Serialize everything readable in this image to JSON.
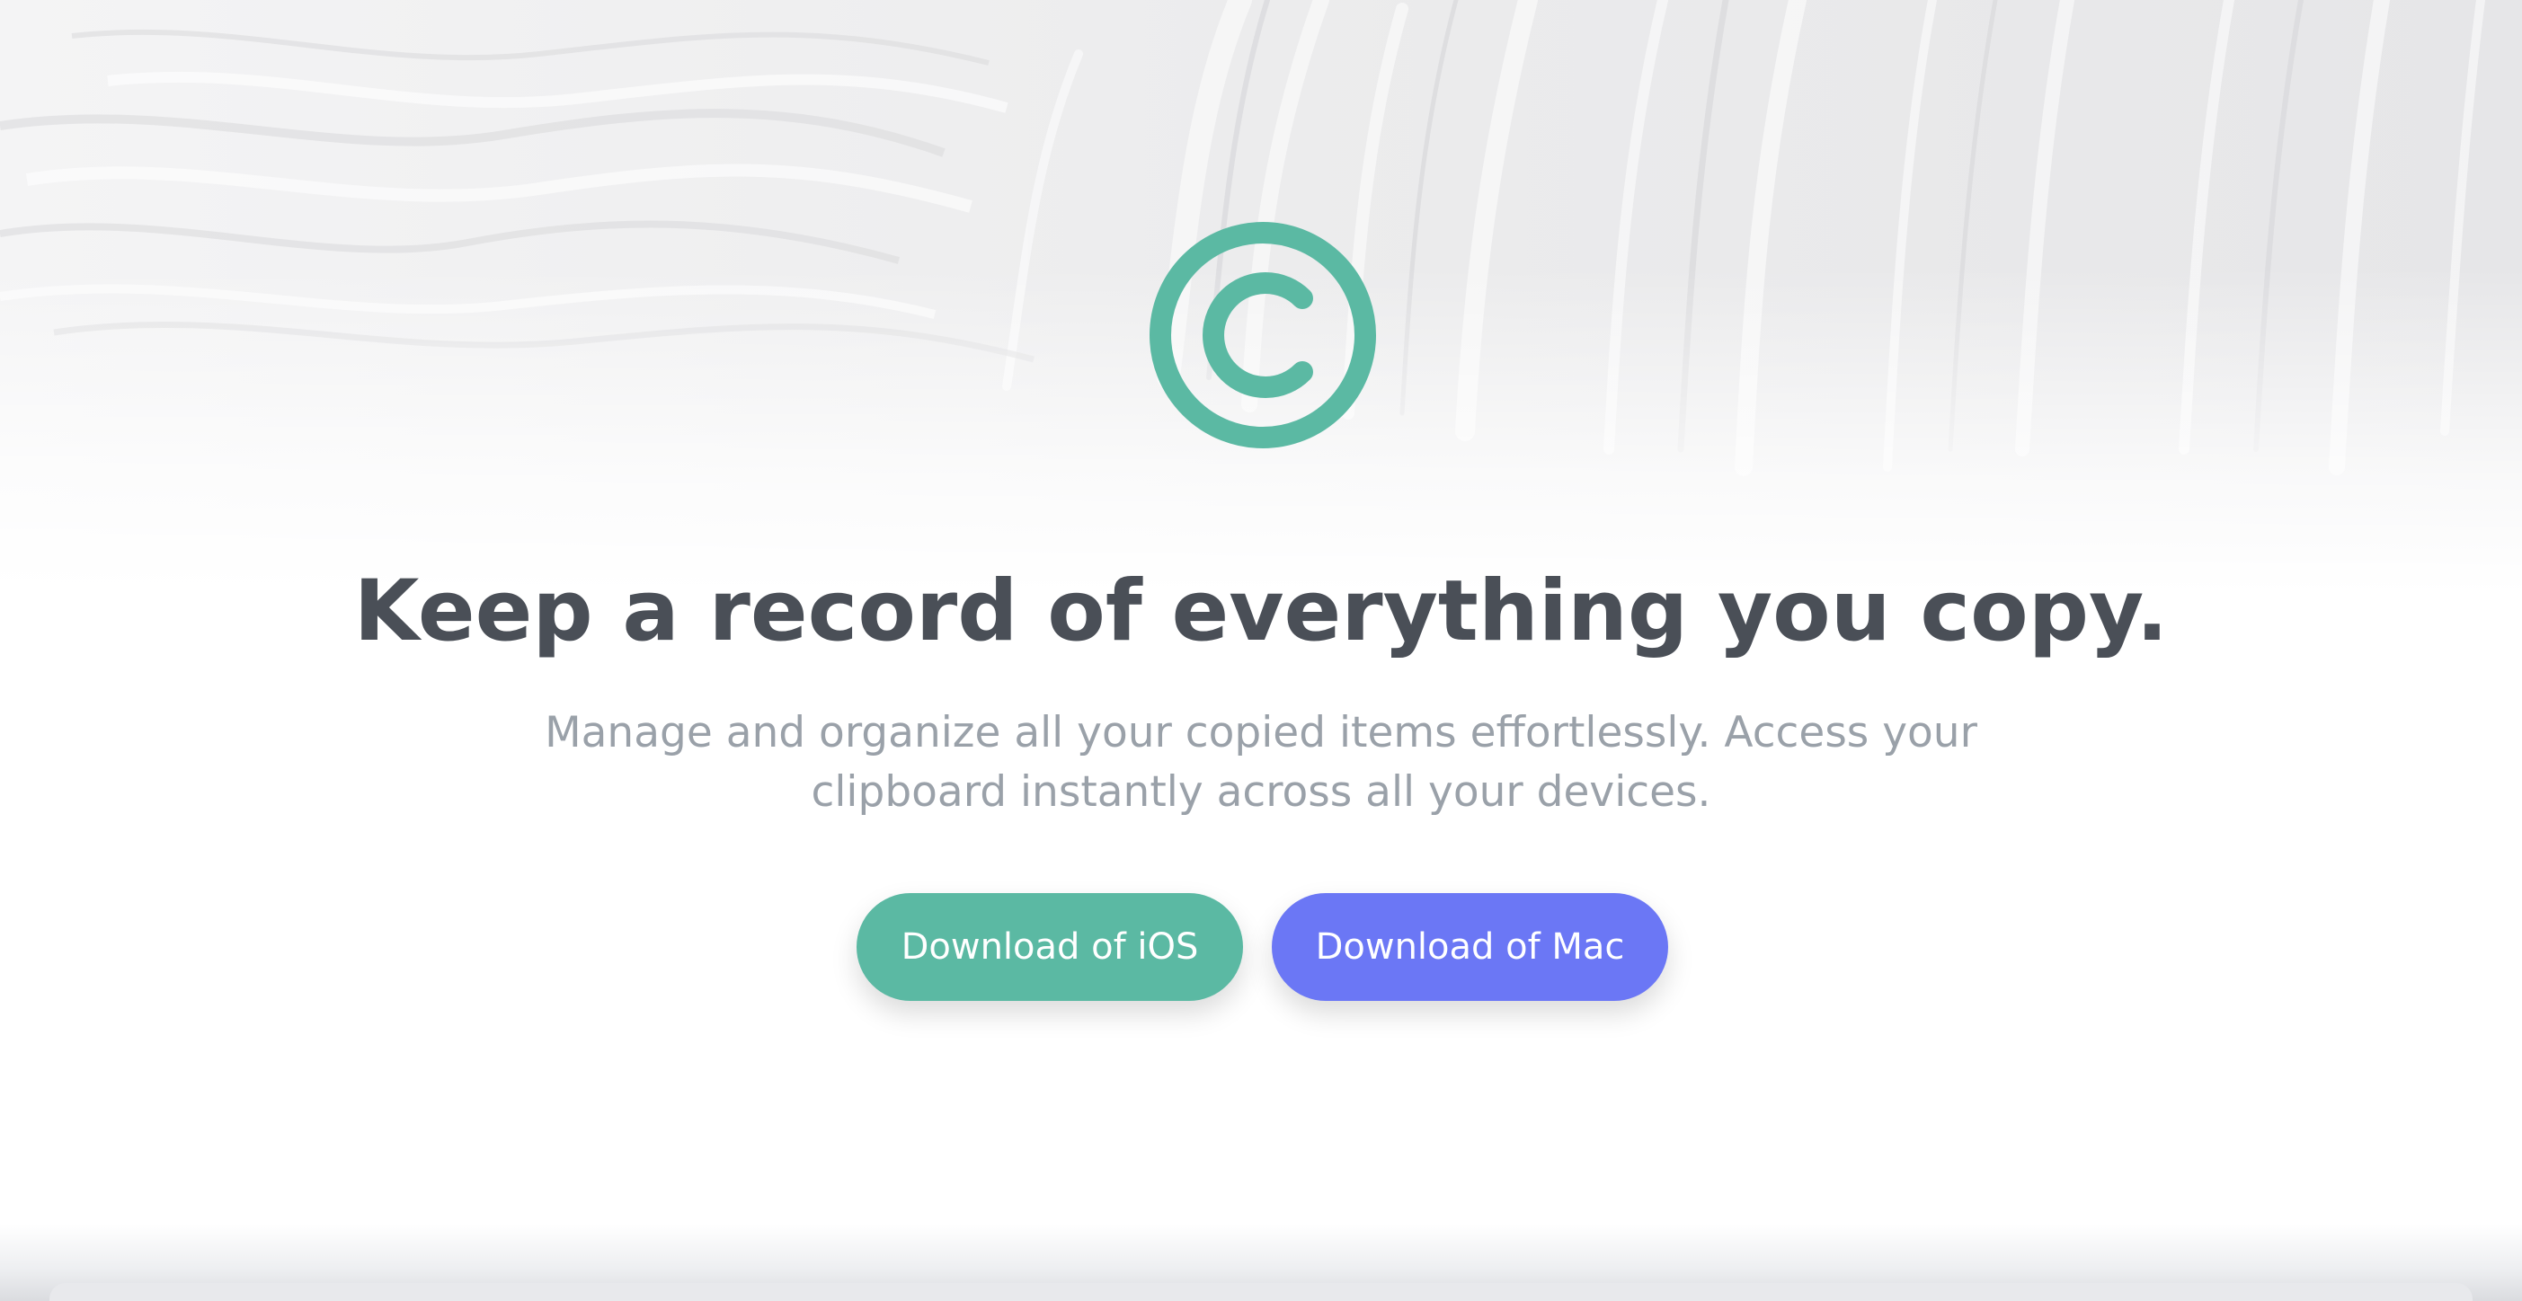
{
  "hero": {
    "logo_icon": "copyright-icon",
    "headline": "Keep a record of everything you copy.",
    "subheadline": "Manage and organize all your copied items effortlessly. Access your clipboard instantly across all your devices."
  },
  "actions": {
    "download_ios_label": "Download of iOS",
    "download_mac_label": "Download of Mac"
  },
  "colors": {
    "brand_green": "#5bb9a3",
    "brand_indigo": "#6b77f5",
    "headline_text": "#4a4f57",
    "subhead_text": "#9aa1a9"
  }
}
